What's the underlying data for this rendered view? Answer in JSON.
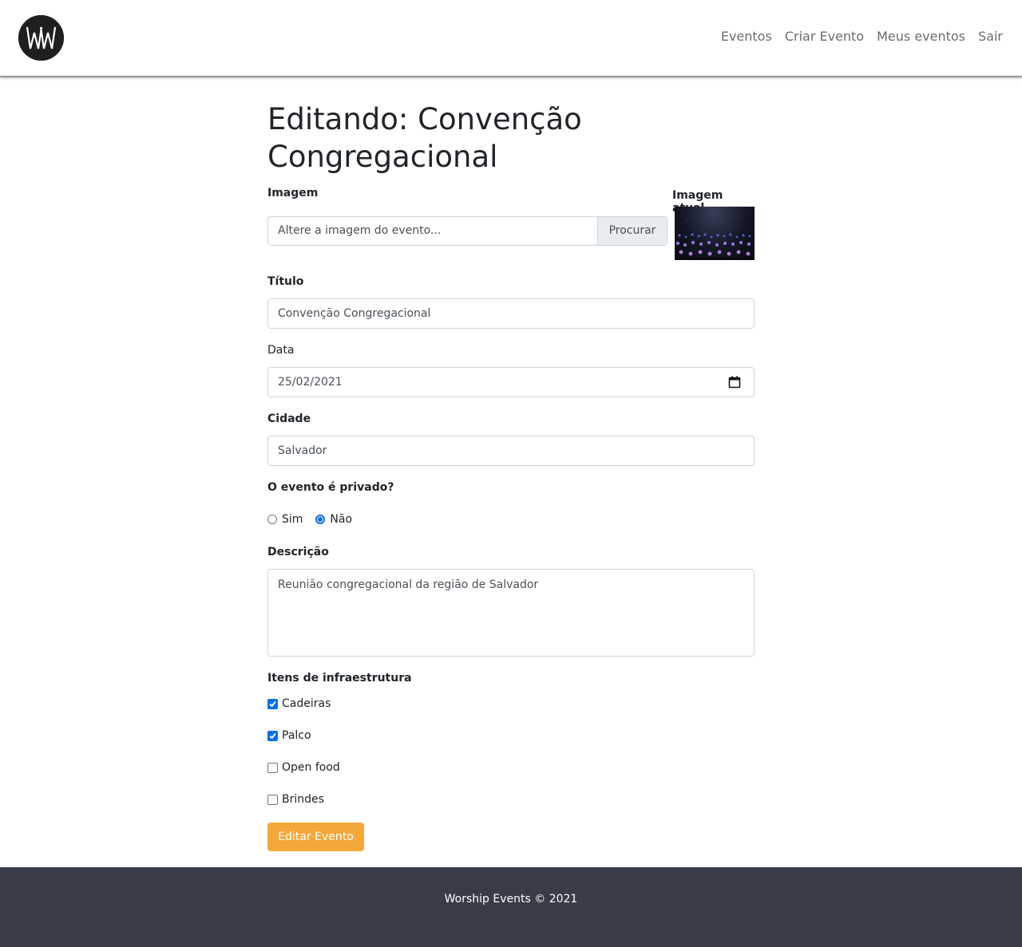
{
  "nav": {
    "links": [
      "Eventos",
      "Criar Evento",
      "Meus eventos",
      "Sair"
    ]
  },
  "page": {
    "title": "Editando: Convenção Congregacional"
  },
  "form": {
    "image_label": "Imagem",
    "image_placeholder": "Altere a imagem do evento...",
    "browse_label": "Procurar",
    "current_image_label": "Imagem atual",
    "title_label": "Título",
    "title_value": "Convenção Congregacional",
    "date_label": "Data",
    "date_value": "25/02/2021",
    "city_label": "Cidade",
    "city_value": "Salvador",
    "private_label": "O evento é privado?",
    "private_options": [
      "Sim",
      "Não"
    ],
    "private_selected": "Não",
    "description_label": "Descrição",
    "description_value": "Reunião congregacional da região de Salvador",
    "infra_label": "Itens de infraestrutura",
    "infra_items": [
      {
        "label": "Cadeiras",
        "checked": true
      },
      {
        "label": "Palco",
        "checked": true
      },
      {
        "label": "Open food",
        "checked": false
      },
      {
        "label": "Brindes",
        "checked": false
      }
    ],
    "submit_label": "Editar Evento"
  },
  "footer": {
    "text": "Worship Events © 2021"
  },
  "colors": {
    "accent": "#f4a83a",
    "footer_bg": "#373c47",
    "check_blue": "#0b6fe0"
  },
  "icons": {
    "logo": "ww-logo-icon",
    "calendar": "calendar-icon"
  }
}
